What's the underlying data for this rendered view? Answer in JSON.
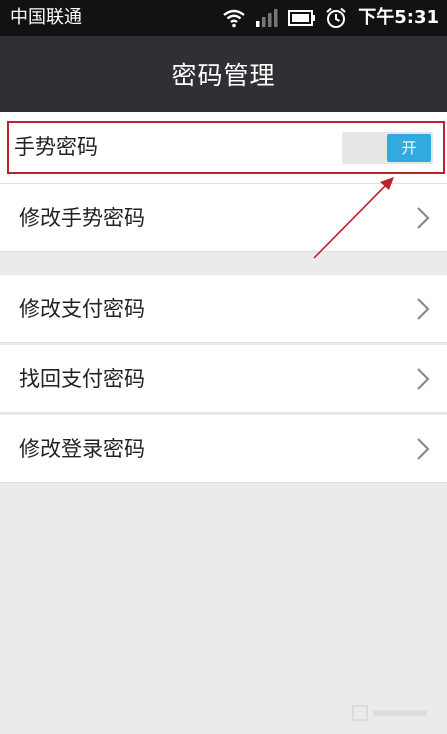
{
  "status_bar": {
    "carrier": "中国联通",
    "time": "下午5:31"
  },
  "header": {
    "title": "密码管理"
  },
  "gesture_setting": {
    "label": "手势密码",
    "toggle_label": "开",
    "toggle_on": true
  },
  "menu": {
    "change_gesture": "修改手势密码",
    "change_payment": "修改支付密码",
    "recover_payment": "找回支付密码",
    "change_login": "修改登录密码"
  },
  "colors": {
    "toggle_on": "#32a9df",
    "highlight_border": "#c0212c",
    "title_bar": "#2e3033"
  }
}
